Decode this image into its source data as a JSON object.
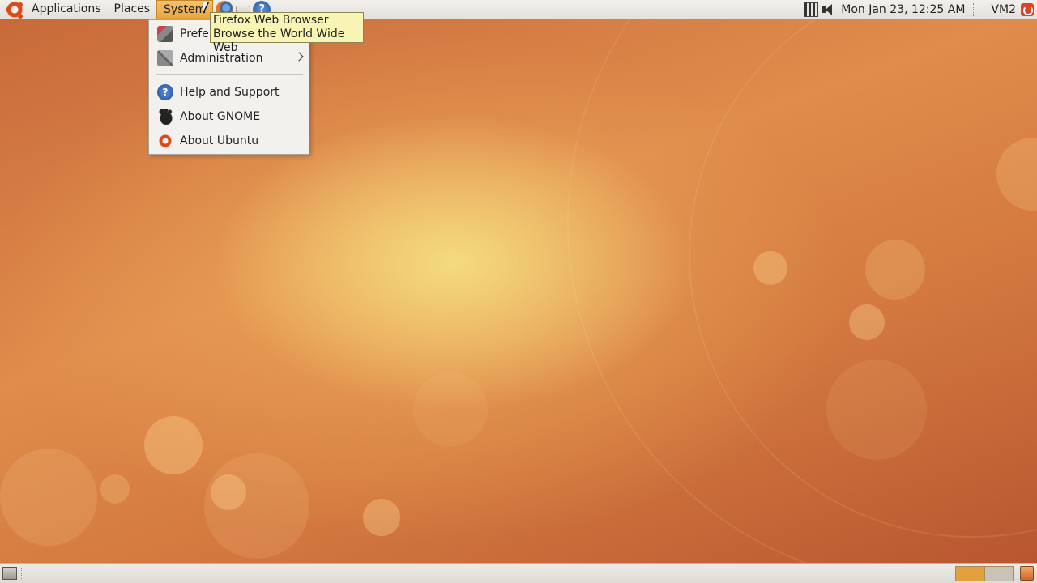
{
  "top_panel": {
    "applications_label": "Applications",
    "places_label": "Places",
    "system_label": "System",
    "launchers": [
      {
        "icon": "firefox-icon"
      },
      {
        "icon": "mail-icon"
      },
      {
        "icon": "help-icon"
      }
    ],
    "clock": "Mon Jan 23, 12:25 AM",
    "user": "VM2"
  },
  "system_menu": {
    "items": [
      {
        "label": "Preferences",
        "icon": "preferences-icon",
        "has_submenu": true
      },
      {
        "label": "Administration",
        "icon": "administration-icon",
        "has_submenu": true
      },
      {
        "label": "Help and Support",
        "icon": "help-icon"
      },
      {
        "label": "About GNOME",
        "icon": "gnome-icon"
      },
      {
        "label": "About Ubuntu",
        "icon": "ubuntu-icon"
      }
    ]
  },
  "tooltip": {
    "title": "Firefox Web Browser",
    "description": "Browse the World Wide Web"
  },
  "bottom_panel": {
    "workspaces": 2,
    "active_workspace": 1
  },
  "colors": {
    "accent": "#e8a53c",
    "ubuntu_orange": "#dd4814",
    "tooltip_bg": "#f8f5b4"
  }
}
